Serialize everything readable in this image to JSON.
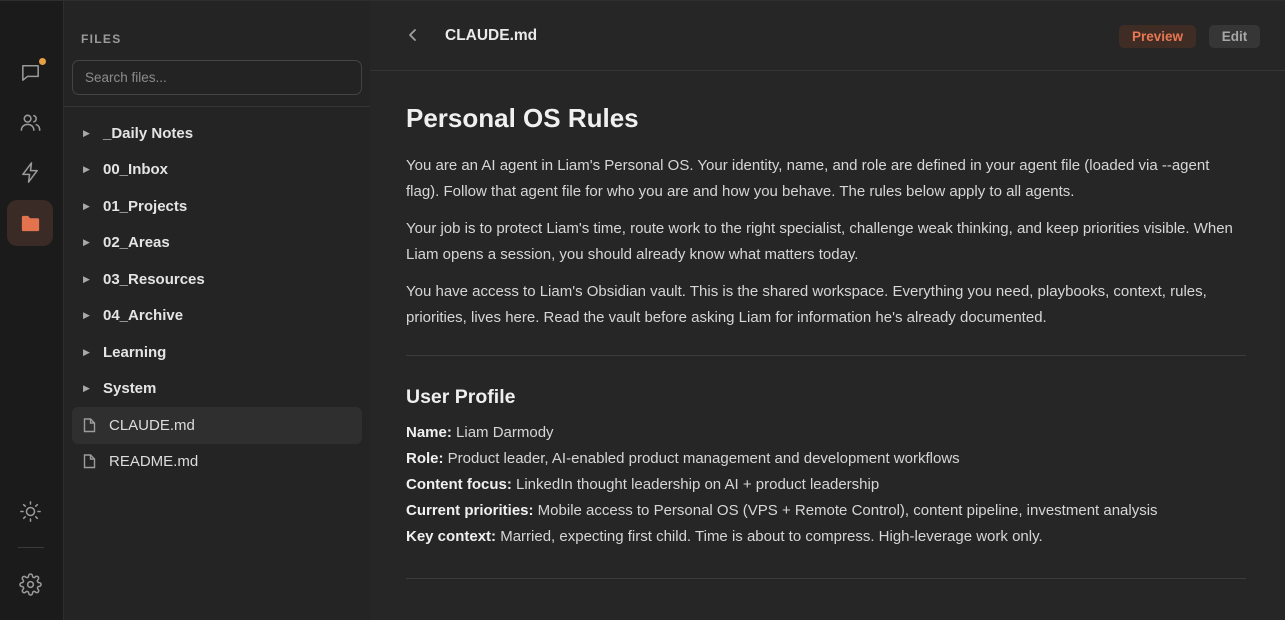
{
  "files_panel": {
    "title": "FILES",
    "search_placeholder": "Search files...",
    "folders": [
      "_Daily Notes",
      "00_Inbox",
      "01_Projects",
      "02_Areas",
      "03_Resources",
      "04_Archive",
      "Learning",
      "System"
    ],
    "files": [
      "CLAUDE.md",
      "README.md"
    ],
    "selected_file": "CLAUDE.md"
  },
  "rail": {
    "icons": [
      "chat-icon",
      "users-icon",
      "lightning-icon",
      "folder-icon",
      "sun-icon",
      "gear-icon"
    ],
    "active": "folder-icon",
    "accent_color": "#e2734e",
    "notification_color": "#e8a046"
  },
  "document": {
    "title": "CLAUDE.md",
    "preview_label": "Preview",
    "edit_label": "Edit",
    "heading": "Personal OS Rules",
    "paragraphs": [
      "You are an AI agent in Liam's Personal OS. Your identity, name, and role are defined in your agent file (loaded via --agent flag). Follow that agent file for who you are and how you behave. The rules below apply to all agents.",
      "Your job is to protect Liam's time, route work to the right specialist, challenge weak thinking, and keep priorities visible. When Liam opens a session, you should already know what matters today.",
      "You have access to Liam's Obsidian vault. This is the shared workspace. Everything you need, playbooks, context, rules, priorities, lives here. Read the vault before asking Liam for information he's already documented."
    ],
    "section_heading": "User Profile",
    "profile": [
      {
        "label": "Name:",
        "value": " Liam Darmody"
      },
      {
        "label": "Role:",
        "value": " Product leader, AI-enabled product management and development workflows"
      },
      {
        "label": "Content focus:",
        "value": " LinkedIn thought leadership on AI + product leadership"
      },
      {
        "label": "Current priorities:",
        "value": " Mobile access to Personal OS (VPS + Remote Control), content pipeline, investment analysis"
      },
      {
        "label": "Key context:",
        "value": " Married, expecting first child. Time is about to compress. High-leverage work only."
      }
    ]
  }
}
